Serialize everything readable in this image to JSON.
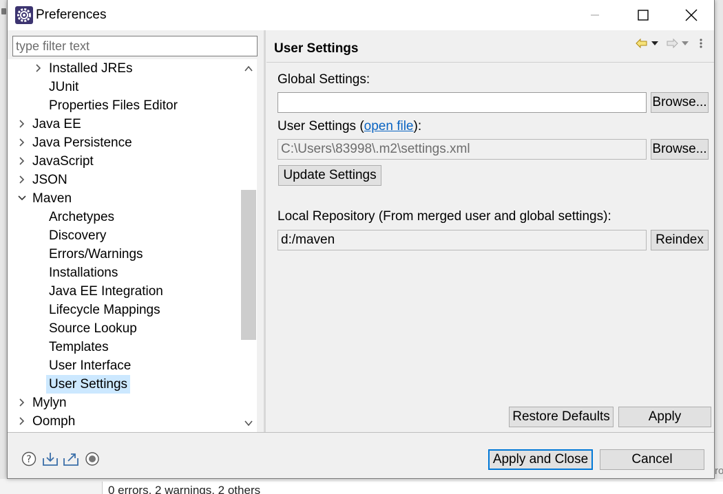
{
  "window": {
    "title": "Preferences"
  },
  "filter": {
    "placeholder": "type filter text"
  },
  "tree": {
    "items": [
      {
        "label": "Installed JREs"
      },
      {
        "label": "JUnit"
      },
      {
        "label": "Properties Files Editor"
      },
      {
        "label": "Java EE"
      },
      {
        "label": "Java Persistence"
      },
      {
        "label": "JavaScript"
      },
      {
        "label": "JSON"
      },
      {
        "label": "Maven"
      },
      {
        "label": "Archetypes"
      },
      {
        "label": "Discovery"
      },
      {
        "label": "Errors/Warnings"
      },
      {
        "label": "Installations"
      },
      {
        "label": "Java EE Integration"
      },
      {
        "label": "Lifecycle Mappings"
      },
      {
        "label": "Source Lookup"
      },
      {
        "label": "Templates"
      },
      {
        "label": "User Interface"
      },
      {
        "label": "User Settings"
      },
      {
        "label": "Mylyn"
      },
      {
        "label": "Oomph"
      }
    ],
    "selected": "User Settings"
  },
  "page": {
    "title": "User Settings",
    "global_settings_label": "Global Settings:",
    "global_settings_value": "",
    "user_settings_label_prefix": "User Settings (",
    "open_file_link": "open file",
    "user_settings_label_suffix": "):",
    "user_settings_value": "C:\\Users\\83998\\.m2\\settings.xml",
    "browse_label": "Browse...",
    "update_settings_label": "Update Settings",
    "local_repo_label": "Local Repository (From merged user and global settings):",
    "local_repo_value": "d:/maven",
    "reindex_label": "Reindex",
    "restore_defaults_label": "Restore Defaults",
    "apply_label": "Apply"
  },
  "footer": {
    "apply_close_label": "Apply and Close",
    "cancel_label": "Cancel"
  },
  "behind": {
    "status_text": "0 errors, 2 warnings, 2 others"
  },
  "colors": {
    "selection": "#cce8ff",
    "link": "#0a64c2",
    "default_button_border": "#0078d7"
  }
}
